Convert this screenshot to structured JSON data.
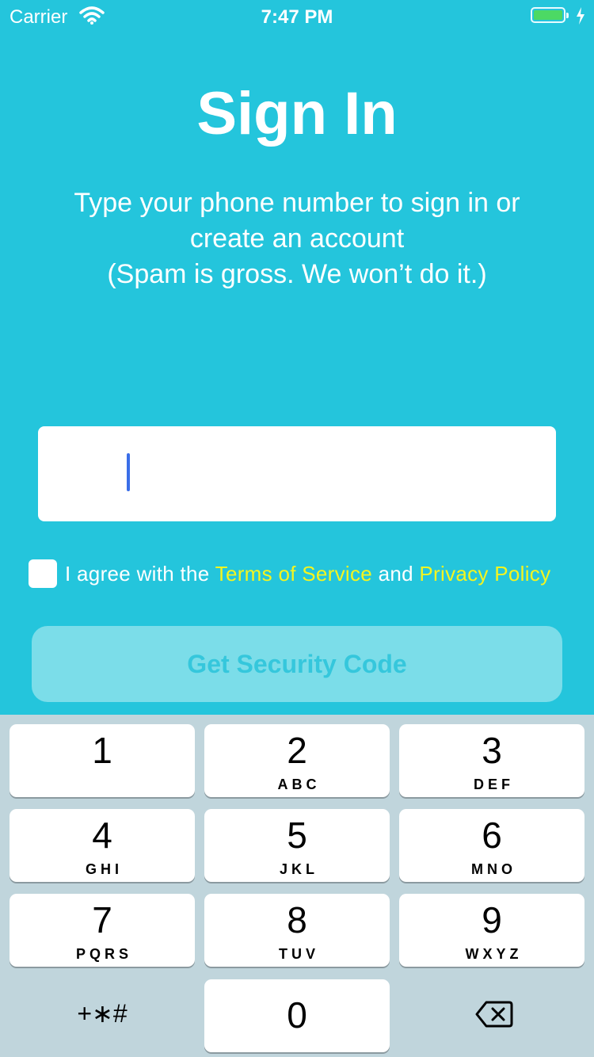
{
  "status_bar": {
    "carrier": "Carrier",
    "time": "7:47 PM",
    "icons": [
      "wifi-icon",
      "battery-icon",
      "charging-bolt-icon"
    ],
    "battery_color": "#4cd964"
  },
  "screen": {
    "title": "Sign In",
    "subtitle_lines": [
      "Type your phone number to sign in or",
      "create an account",
      "(Spam is gross. We won’t do it.)"
    ]
  },
  "phone_input": {
    "value": "",
    "caret_color": "#3a6ee8"
  },
  "agreement": {
    "checked": false,
    "prefix": "I agree with the",
    "terms_link": "Terms of Service",
    "conjunction": "and",
    "privacy_link": "Privacy Policy",
    "link_color": "#f4f51f"
  },
  "cta": {
    "label": "Get Security Code",
    "enabled": false
  },
  "keypad": {
    "keys": [
      {
        "digit": "1",
        "letters": ""
      },
      {
        "digit": "2",
        "letters": "ABC"
      },
      {
        "digit": "3",
        "letters": "DEF"
      },
      {
        "digit": "4",
        "letters": "GHI"
      },
      {
        "digit": "5",
        "letters": "JKL"
      },
      {
        "digit": "6",
        "letters": "MNO"
      },
      {
        "digit": "7",
        "letters": "PQRS"
      },
      {
        "digit": "8",
        "letters": "TUV"
      },
      {
        "digit": "9",
        "letters": "WXYZ"
      },
      {
        "digit": "0",
        "letters": ""
      }
    ],
    "symbols_label": "+∗#",
    "delete_icon": "backspace-icon"
  },
  "colors": {
    "background": "#24c5dc",
    "keypad_background": "#c0d5dc",
    "cta_background": "#7bdde9",
    "cta_text": "#35c7dc"
  }
}
